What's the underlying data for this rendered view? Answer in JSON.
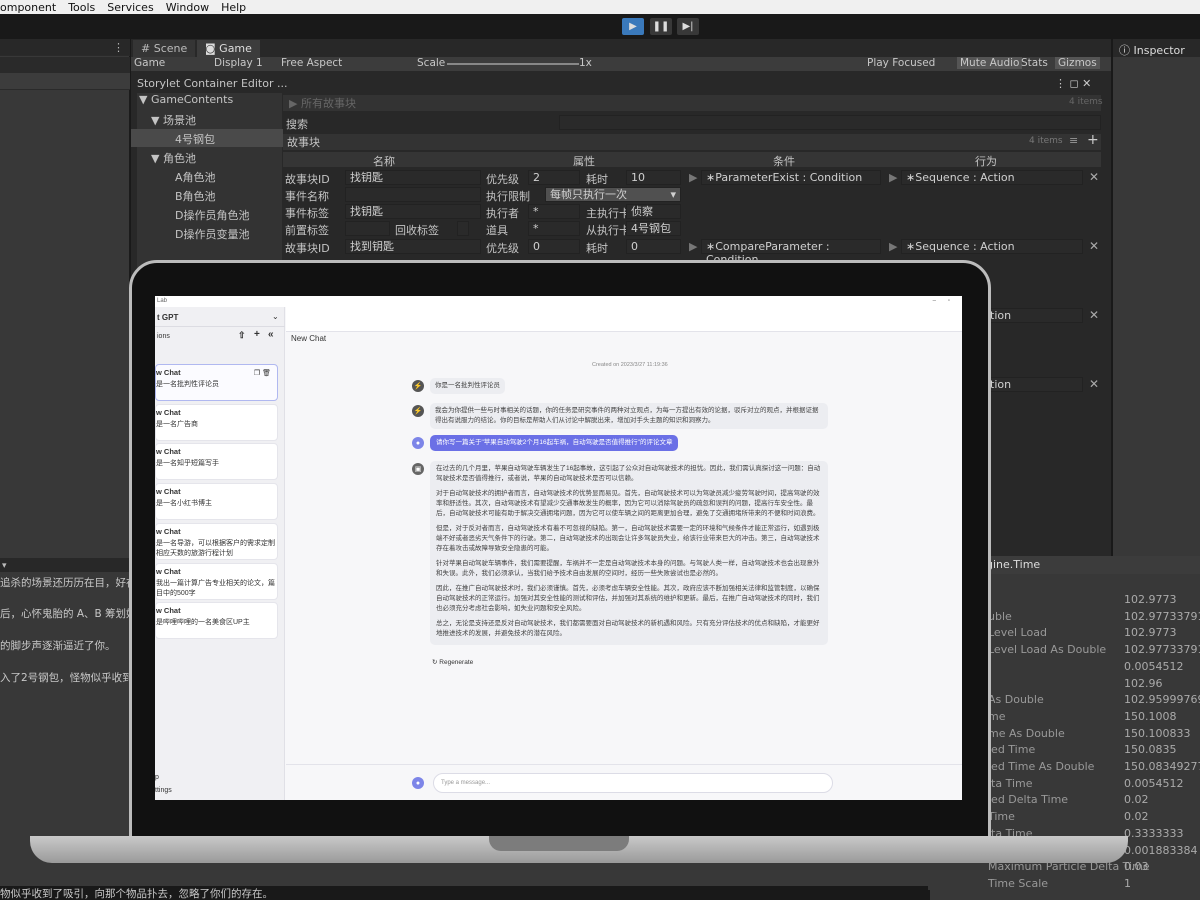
{
  "menu": [
    "omponent",
    "Tools",
    "Services",
    "Window",
    "Help"
  ],
  "toolbar": {
    "play_icon": "play-icon",
    "pause_icon": "pause-icon",
    "step_icon": "step-icon"
  },
  "tabs": {
    "scene": "# Scene",
    "game": "Game",
    "inspector": "Inspector"
  },
  "gamebar": {
    "game": "Game",
    "display": "Display 1",
    "aspect": "Free Aspect",
    "scale": "Scale",
    "scale_value": "1x",
    "play_focused": "Play Focused",
    "mute": "Mute Audio",
    "stats": "Stats",
    "gizmos": "Gizmos"
  },
  "editor": {
    "title": "Storylet Container Editor ...",
    "tree": [
      "GameContents",
      "场景池",
      "4号钢包",
      "角色池",
      "A角色池",
      "B角色池",
      "D操作员角色池",
      "D操作员变量池"
    ],
    "all_stories": "所有故事块",
    "all_items": "4 items",
    "search": "搜索",
    "story_block": "故事块",
    "story_items": "4 items",
    "columns": [
      "名称",
      "属性",
      "条件",
      "行为"
    ],
    "row1": {
      "id_label": "故事块ID",
      "id": "找钥匙",
      "priority_label": "优先级",
      "priority": "2",
      "duration_label": "耗时",
      "duration": "10",
      "condition": "∗ParameterExist : Condition",
      "action": "∗Sequence : Action",
      "name_label": "事件名称",
      "limit_label": "执行限制",
      "limit": "每帧只执行一次",
      "tag_label": "事件标签",
      "tag": "找钥匙",
      "executor_label": "执行者",
      "executor": "*",
      "main_card_label": "主执行卡",
      "main_card": "侦察",
      "pre_tag_label": "前置标签",
      "recycle_label": "回收标签",
      "prop_label": "道具",
      "prop": "*",
      "sub_card_label": "从执行卡",
      "sub_card": "4号钢包"
    },
    "row2": {
      "id_label": "故事块ID",
      "id": "找到钥匙",
      "priority_label": "优先级",
      "priority": "0",
      "duration_label": "耗时",
      "duration": "0",
      "condition": "∗CompareParameter : Condition",
      "action": "∗Sequence : Action"
    },
    "partial_a": "tion",
    "partial_b": "tion"
  },
  "console": [
    "追杀的场景还历历在目，好在",
    "后，心怀鬼胎的 A、B 筹划好",
    "的脚步声逐渐逼近了你。",
    "入了2号钢包，怪物似乎收到了",
    "物似乎收到了吸引，向那个物品扑去，忽略了你们的存在。"
  ],
  "time_panel": {
    "title": "gine.Time",
    "rows": [
      {
        "label": "",
        "value": "102.9773"
      },
      {
        "label": "uble",
        "value": "102.977337918"
      },
      {
        "label": "Level Load",
        "value": "102.9773"
      },
      {
        "label": "Level Load As Double",
        "value": "102.977337918"
      },
      {
        "label": "",
        "value": "0.0054512"
      },
      {
        "label": "",
        "value": "102.96"
      },
      {
        "label": "As Double",
        "value": "102.959997698"
      },
      {
        "label": "me",
        "value": "150.1008"
      },
      {
        "label": "me As Double",
        "value": "150.100833"
      },
      {
        "label": "led Time",
        "value": "150.0835"
      },
      {
        "label": "led Time As Double",
        "value": "150.083492775"
      },
      {
        "label": "lta Time",
        "value": "0.0054512"
      },
      {
        "label": "led Delta Time",
        "value": "0.02"
      },
      {
        "label": "Time",
        "value": "0.02"
      },
      {
        "label": "lta Time",
        "value": "0.3333333"
      },
      {
        "label": "",
        "value": "0.001883384"
      },
      {
        "label": "Maximum Particle Delta Time",
        "value": "0.03"
      },
      {
        "label": "Time Scale",
        "value": "1"
      }
    ]
  },
  "chat": {
    "app_title": "Lab",
    "model": "t GPT",
    "sessions_label": "ions",
    "header": "New Chat",
    "created": "Created on 2023/3/27 11:19:36",
    "sessions": [
      {
        "title": "w Chat",
        "sub": "是一名批判性评论员"
      },
      {
        "title": "w Chat",
        "sub": "是一名广告商"
      },
      {
        "title": "w Chat",
        "sub": "是一名知乎短篇写手"
      },
      {
        "title": "w Chat",
        "sub": "是一名小红书博主"
      },
      {
        "title": "w Chat",
        "sub": "是一名导游，可以根据客户的需求定制相应天数的旅游行程计划"
      },
      {
        "title": "w Chat",
        "sub": "我出一篇计算广告专业相关的论文，篇目中的500字"
      },
      {
        "title": "w Chat",
        "sub": "是哔哩哔哩的一名美食区UP主"
      }
    ],
    "help": "p",
    "settings": "ttings",
    "messages": [
      "你是一名批判性评论员",
      "我会为你提供一些与时事相关的话题，你的任务是研究事件的两种对立观点，为每一方提出有效的论据，驳斥对立的观点，并根据证据得出有说服力的结论。你的目标是帮助人们从讨论中解脱出来，增加对手头主题的知识和洞察力。",
      "请你写一篇关于\"苹果自动驾驶2个月16起车祸，自动驾驶是否值得推行\"的评论文章",
      "在过去的几个月里，苹果自动驾驶车辆发生了16起事故，这引起了公众对自动驾驶技术的担忧。因此，我们需认真探讨这一问题：自动驾驶技术是否值得推行，或者说，苹果的自动驾驶技术是否可以信赖。",
      "对于自动驾驶技术的拥护者而言，自动驾驶技术的优势显而易见。首先，自动驾驶技术可以为驾驶员减少疲劳驾驶时间，提高驾驶的效率和舒适性。其次，自动驾驶技术有望减少交通事故发生的概率，因为它可以消除驾驶员的疏忽和误判的问题，提高行车安全性。最后，自动驾驶技术可能有助于解决交通拥堵问题，因为它可以使车辆之间的距离更加合理，避免了交通拥堵所带来的不便和时间浪费。",
      "但是，对于反对者而言，自动驾驶技术有着不可忽视的缺陷。第一，自动驾驶技术需要一定的环境和气候条件才能正常运行，如遇到极端不好或者恶劣天气条件下的行驶。第二，自动驾驶技术的出现会让许多驾驶员失业，给该行业带来巨大的冲击。第三，自动驾驶技术存在着攻击或故障导致安全隐患的可能。",
      "针对苹果自动驾驶车辆事件，我们需要提醒，车祸并不一定是自动驾驶技术本身的问题。与驾驶人类一样，自动驾驶技术也会出现意外和失误。此外，我们必须承认，当我们给予技术自由发展的空间时，经历一些失败尝试也是必然的。",
      "因此，在推广自动驾驶技术时，我们必须谨慎。首先，必须考虑车辆安全性能。其次，政府应该不断加强相关法律和监管制度，以确保自动驾驶技术的正常运行。加强对其安全性能的测试和评估，并加强对其系统的维护和更新。最后，在推广自动驾驶技术的同时，我们也必须充分考虑社会影响，如失业问题和安全风险。",
      "总之，无论是支持还是反对自动驾驶技术，我们都需要面对自动驾驶技术的新机遇和风险。只有充分评估技术的优点和缺陷，才能更好地推进技术的发展，并避免技术的潜在风险。"
    ],
    "regenerate": "Regenerate",
    "input_placeholder": "Type a message..."
  }
}
